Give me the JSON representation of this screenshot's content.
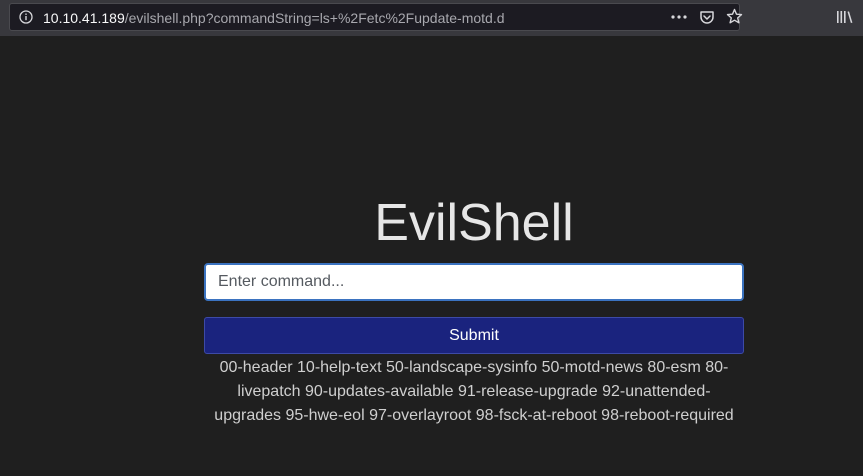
{
  "browser": {
    "url_host": "10.10.41.189",
    "url_path": "/evilshell.php?commandString=ls+%2Fetc%2Fupdate-motd.d",
    "icons": {
      "site_info": "info-icon",
      "page_actions": "ellipsis-icon",
      "pocket": "pocket-icon",
      "bookmark": "star-icon",
      "library": "library-icon"
    }
  },
  "page": {
    "title": "EvilShell",
    "command_input": {
      "value": "",
      "placeholder": "Enter command..."
    },
    "submit_label": "Submit",
    "output_text": "00-header 10-help-text 50-landscape-sysinfo 50-motd-news 80-esm 80-livepatch 90-updates-available 91-release-upgrade 92-unattended-upgrades 95-hwe-eol 97-overlayroot 98-fsck-at-reboot 98-reboot-required"
  },
  "colors": {
    "background": "#1f1f1f",
    "button": "#1a237e",
    "input_border": "#3b73c0",
    "text": "#cfcfcf"
  }
}
